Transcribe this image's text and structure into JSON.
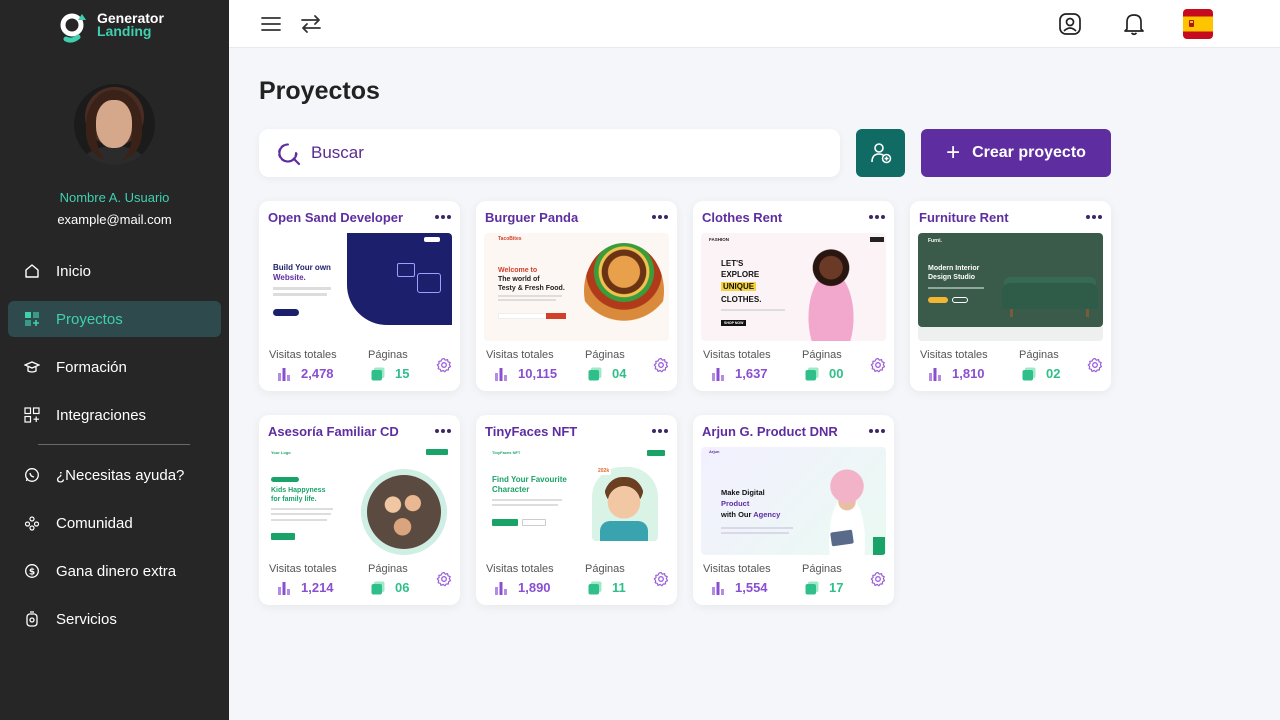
{
  "brand": {
    "line1": "Generator",
    "line2": "Landing"
  },
  "user": {
    "name": "Nombre A. Usuario",
    "email": "example@mail.com"
  },
  "nav": [
    {
      "label": "Inicio",
      "icon": "home-icon"
    },
    {
      "label": "Proyectos",
      "icon": "grid-plus-icon",
      "active": true
    },
    {
      "label": "Formación",
      "icon": "graduation-icon"
    },
    {
      "label": "Integraciones",
      "icon": "apps-add-icon"
    },
    {
      "label": "¿Necesitas ayuda?",
      "icon": "whatsapp-icon"
    },
    {
      "label": "Comunidad",
      "icon": "community-icon"
    },
    {
      "label": "Gana dinero extra",
      "icon": "dollar-coin-icon"
    },
    {
      "label": "Servicios",
      "icon": "services-icon"
    }
  ],
  "header": {
    "language": "Español"
  },
  "page": {
    "title": "Proyectos",
    "search_placeholder": "Buscar",
    "create_label": "Crear proyecto",
    "visits_label": "Visitas totales",
    "pages_label": "Páginas"
  },
  "projects": [
    {
      "name": "Open Sand Developer",
      "visits": "2,478",
      "pages": "15",
      "thumb": {
        "headline": "Build Your own",
        "headline2": "Website."
      }
    },
    {
      "name": "Burguer Panda",
      "visits": "10,115",
      "pages": "04",
      "thumb": {
        "brand": "TacoBites",
        "headline": "Welcome to",
        "headline2": "The world of",
        "headline3": "Testy & Fresh Food."
      }
    },
    {
      "name": "Clothes Rent",
      "visits": "1,637",
      "pages": "00",
      "thumb": {
        "brand": "FASHION",
        "headline": "LET'S",
        "headline2": "EXPLORE",
        "headline3": "UNIQUE",
        "headline4": "CLOTHES.",
        "button": "SHOP NOW"
      }
    },
    {
      "name": "Furniture Rent",
      "visits": "1,810",
      "pages": "02",
      "thumb": {
        "brand": "Furni.",
        "headline": "Modern Interior",
        "headline2": "Design Studio"
      }
    },
    {
      "name": "Asesoría Familiar CD",
      "visits": "1,214",
      "pages": "06",
      "thumb": {
        "brand": "Your Logo",
        "headline": "Kids Happyness",
        "headline2": "for family life."
      }
    },
    {
      "name": "TinyFaces NFT",
      "visits": "1,890",
      "pages": "11",
      "thumb": {
        "brand": "TinyFaces NFT",
        "headline": "Find Your Favourite",
        "headline2": "Character",
        "badge": "202k"
      }
    },
    {
      "name": "Arjun G. Product DNR",
      "visits": "1,554",
      "pages": "17",
      "thumb": {
        "brand": "Arjun",
        "headline": "Make Digital",
        "headline2": "Product",
        "headline3": "with Our",
        "headline4": "Agency"
      }
    }
  ],
  "colors": {
    "sidebar": "#262626",
    "accent_teal": "#3fd0b0",
    "purple": "#5e2ea1",
    "dark_teal": "#0f6b63"
  }
}
